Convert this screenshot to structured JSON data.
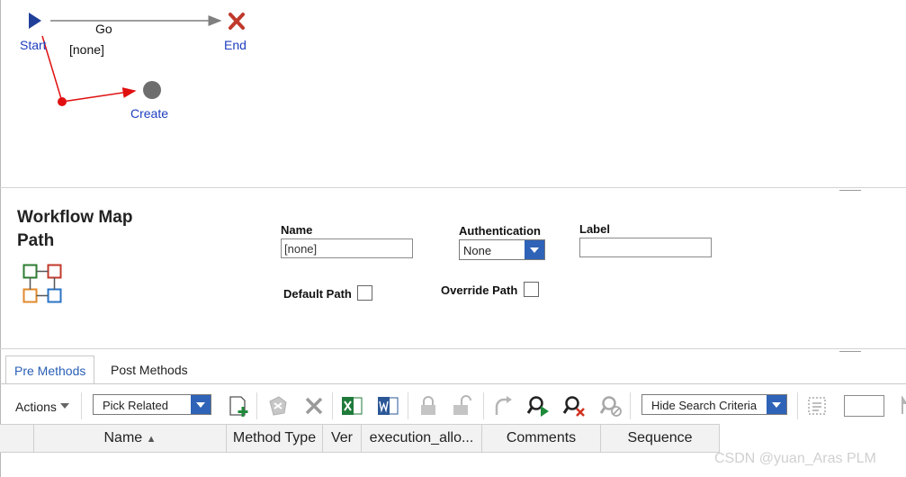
{
  "map": {
    "nodes": {
      "start": "Start",
      "end": "End",
      "create": "Create"
    },
    "paths": {
      "go": "Go",
      "none": "[none]"
    },
    "colors": {
      "start_node": "#1f3f99",
      "end_node": "#c0392b",
      "activity_node": "#6e6e6e",
      "path": "#7f7f7f",
      "selected_path": "#e01010",
      "node_label": "#1f3fbf"
    }
  },
  "form": {
    "title": "Workflow Map Path",
    "icon": "workflow-map-icon",
    "name_label": "Name",
    "name_value": "[none]",
    "authentication_label": "Authentication",
    "authentication_value": "None",
    "label_label": "Label",
    "label_value": "",
    "default_path_label": "Default Path",
    "default_path_checked": false,
    "override_path_label": "Override Path",
    "override_path_checked": false
  },
  "tabs": [
    {
      "label": "Pre Methods",
      "active": true
    },
    {
      "label": "Post Methods",
      "active": false
    }
  ],
  "toolbar": {
    "actions_label": "Actions",
    "pick_related_value": "Pick Related",
    "search_mode_value": "Hide Search Criteria",
    "page_value": ""
  },
  "grid": {
    "columns": [
      "Name",
      "Method Type",
      "Ver",
      "execution_allo...",
      "Comments",
      "Sequence"
    ],
    "sort_column": "Name",
    "sort_direction": "ascending"
  },
  "watermark": "CSDN @yuan_Aras PLM"
}
